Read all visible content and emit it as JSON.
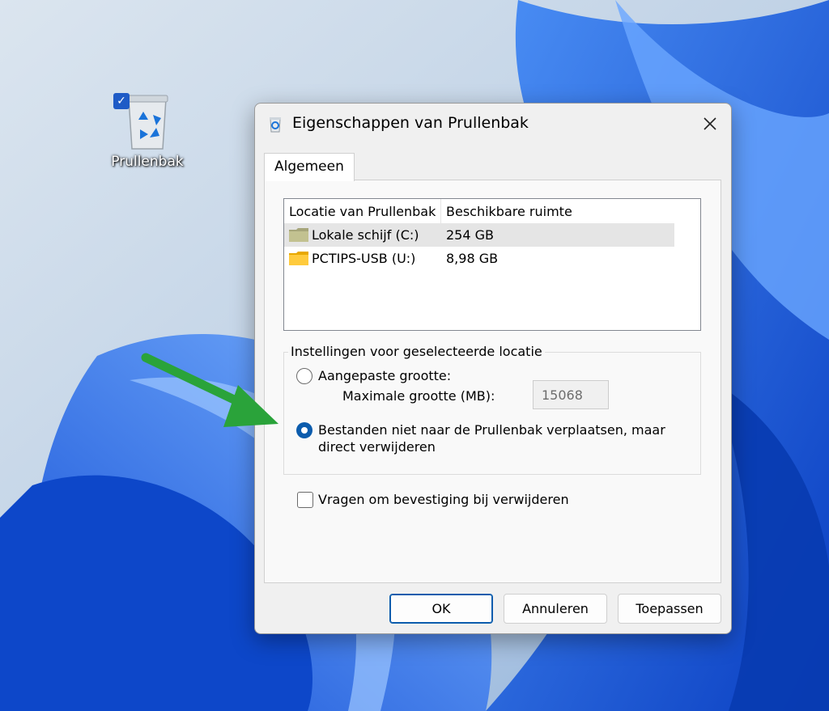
{
  "desktop": {
    "recycle_bin_label": "Prullenbak"
  },
  "dialog": {
    "title": "Eigenschappen van Prullenbak",
    "tab": "Algemeen",
    "list": {
      "headers": [
        "Locatie van Prullenbak",
        "Beschikbare ruimte"
      ],
      "rows": [
        {
          "location": "Lokale schijf (C:)",
          "space": "254 GB",
          "selected": true,
          "icon": "drive-folder-icon"
        },
        {
          "location": "PCTIPS-USB (U:)",
          "space": "8,98 GB",
          "selected": false,
          "icon": "folder-icon"
        }
      ]
    },
    "group": {
      "label": "Instellingen voor geselecteerde locatie",
      "custom_size_label": "Aangepaste grootte:",
      "max_size_label": "Maximale grootte (MB):",
      "max_size_value": "15068",
      "delete_direct_line1": "Bestanden niet naar de Prullenbak verplaatsen, maar",
      "delete_direct_line2": "direct verwijderen",
      "selected_option": "delete_direct"
    },
    "confirm_label": "Vragen om bevestiging bij verwijderen",
    "confirm_checked": false,
    "buttons": {
      "ok": "OK",
      "cancel": "Annuleren",
      "apply": "Toepassen"
    }
  },
  "colors": {
    "accent": "#0b5cad",
    "annotation_arrow": "#2aa33a",
    "wallpaper_blue": "#1a5fe0"
  }
}
